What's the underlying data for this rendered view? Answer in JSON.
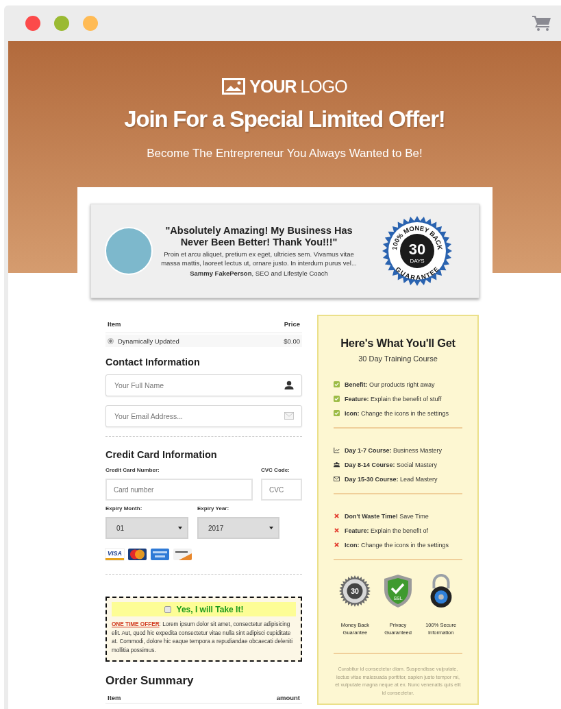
{
  "window": {
    "controls": [
      {
        "color": "#fc4a4a"
      },
      {
        "color": "#9aba32"
      },
      {
        "color": "#ffbb55"
      }
    ]
  },
  "header": {
    "logo": "**YOUR** LOGO",
    "title": "Join For a Special Limited Offer!",
    "subtitle": "Become The Entrepreneur You Always Wanted to Be!"
  },
  "testimonial": {
    "quote": "\"Absolutely Amazing! My Business Has Never Been Better! Thank You!!!\"",
    "body": "Proin et arcu aliquet, pretium ex eget, ultricies sem. Vivamus vitae massa mattis, laoreet lectus ut, ornare justo. In interdum purus vel...",
    "author": "**Sammy FakePerson**, SEO and Lifestyle Coach",
    "badge": {
      "top": "100% MONEY BACK",
      "number": "30",
      "unit": "DAYS",
      "bottom": "GUARANTEE"
    }
  },
  "product_table": {
    "columns": [
      "Item",
      "Price"
    ],
    "rows": [
      {
        "name": "Dynamically Updated",
        "price": "$0.00",
        "selected": true
      }
    ]
  },
  "contact": {
    "heading": "Contact Information",
    "fields": [
      {
        "kind": "person",
        "placeholder": "Your Full Name"
      },
      {
        "kind": "email",
        "placeholder": "Your Email Address..."
      }
    ]
  },
  "credit_card": {
    "heading": "Credit Card Information",
    "number_label": "Credit Card Number:",
    "number_placeholder": "Card number",
    "cvc_label": "CVC Code:",
    "cvc_placeholder": "CVC",
    "month_label": "Expiry Month:",
    "month_value": "01",
    "year_label": "Expiry Year:",
    "year_value": "2017",
    "card_logos": [
      {
        "kind": "visa",
        "label": "VISA"
      },
      {
        "kind": "mastercard"
      },
      {
        "kind": "amex"
      },
      {
        "kind": "discover"
      }
    ]
  },
  "offer": {
    "checked": false,
    "label": "Yes, I will Take It!",
    "lead": "ONE TIME OFFER",
    "text": ": Lorem ipsum dolor sit amet, consectetur adipisicing elit. Aut, quod hic expedita consectetur vitae nulla sint adipisci cupiditate at. Commodi, dolore hic eaque tempora a repudiandae obcaecati deleniti mollitia possimus."
  },
  "order_summary": {
    "heading": "Order Summary",
    "columns": [
      "Item",
      "amount"
    ]
  },
  "sidebar": {
    "title": "Here's What You'll Get",
    "subtitle": "30 Day Training Course",
    "groups": [
      [
        {
          "kind": "check",
          "text": "**Benefit:** Our products right away"
        },
        {
          "kind": "check",
          "text": "**Feature:** Explain the benefit of stuff"
        },
        {
          "kind": "check",
          "text": "**Icon:** Change the icons in the settings"
        }
      ],
      [
        {
          "kind": "chart",
          "text": "**Day 1-7 Course:** Business Mastery"
        },
        {
          "kind": "users",
          "text": "**Day 8-14 Course:** Social Mastery"
        },
        {
          "kind": "envelope",
          "text": "**Day 15-30 Course:** Lead Mastery"
        }
      ],
      [
        {
          "kind": "cross",
          "text": "**Don't Waste Time!** Save Time"
        },
        {
          "kind": "cross",
          "text": "**Feature:** Explain the benefit of"
        },
        {
          "kind": "cross",
          "text": "**Icon:** Change the icons in the settings"
        }
      ]
    ],
    "trust_badges": [
      {
        "kind": "seal",
        "mark": "30",
        "label": "Money Back Guarantee"
      },
      {
        "kind": "shield",
        "mark": "SSL",
        "label": "Privacy Guaranteed"
      },
      {
        "kind": "lock",
        "label": "100% Secure Information"
      }
    ],
    "footer": "Curabitur id consectetur diam. Suspendisse vulputate, lectus vitae malesuada porttitor, sapien justo tempor mi, et vulputate magna neque at ex. Nunc venenatis quis elit id consectetur."
  }
}
